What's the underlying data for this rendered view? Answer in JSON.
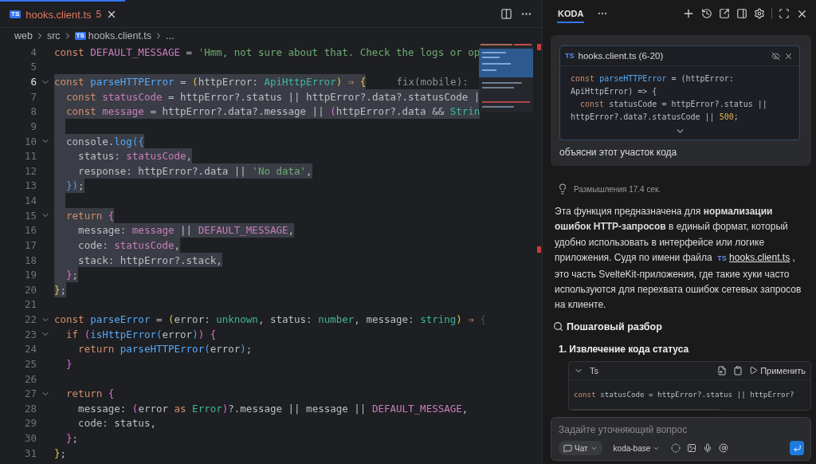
{
  "editor_tab": {
    "badge": "TS",
    "label": "hooks.client.ts",
    "problems": "5",
    "selected": true
  },
  "breadcrumb": [
    {
      "label": "web"
    },
    {
      "label": "src"
    },
    {
      "label": "hooks.client.ts",
      "badge": "TS"
    },
    {
      "label": "..."
    }
  ],
  "code_lines": [
    {
      "number": "4",
      "selected": false,
      "current": false,
      "foldable": false,
      "tokens": [
        {
          "kind": "kw",
          "text": "const "
        },
        {
          "kind": "var",
          "text": "DEFAULT_MESSAGE"
        },
        {
          "kind": "plain",
          "text": " = "
        },
        {
          "kind": "str",
          "text": "'Hmm, not sure about that. Check the logs or op"
        }
      ]
    },
    {
      "number": "5",
      "selected": false,
      "current": false,
      "foldable": false
    },
    {
      "number": "6",
      "selected": true,
      "current": true,
      "foldable": true,
      "annotation": "fix(mobile):",
      "tokens": [
        {
          "kind": "kw",
          "text": "const "
        },
        {
          "kind": "fn",
          "text": "parseHTTPError"
        },
        {
          "kind": "plain",
          "text": " = "
        },
        {
          "kind": "b1",
          "text": "("
        },
        {
          "kind": "plain",
          "text": "httpError: "
        },
        {
          "kind": "type",
          "text": "ApiHttpError"
        },
        {
          "kind": "b1",
          "text": ")"
        },
        {
          "kind": "kw",
          "text": " ⇒ "
        },
        {
          "kind": "b1",
          "text": "{"
        }
      ]
    },
    {
      "number": "7",
      "selected": true,
      "current": false,
      "foldable": false,
      "tokens": [
        {
          "kind": "kw",
          "text": "  const "
        },
        {
          "kind": "var",
          "text": "statusCode"
        },
        {
          "kind": "plain",
          "text": " = httpError?.status || httpError?.data?.statusCode |"
        }
      ]
    },
    {
      "number": "8",
      "selected": true,
      "current": false,
      "foldable": false,
      "tokens": [
        {
          "kind": "kw",
          "text": "  const "
        },
        {
          "kind": "var",
          "text": "message"
        },
        {
          "kind": "plain",
          "text": " = httpError?.data?.message || "
        },
        {
          "kind": "b2",
          "text": "("
        },
        {
          "kind": "plain",
          "text": "httpError?.data && "
        },
        {
          "kind": "type",
          "text": "Strin"
        }
      ]
    },
    {
      "number": "9",
      "selected": true,
      "current": false,
      "foldable": false
    },
    {
      "number": "10",
      "selected": true,
      "current": false,
      "foldable": true,
      "tokens": [
        {
          "kind": "plain",
          "text": "  console."
        },
        {
          "kind": "fn",
          "text": "log"
        },
        {
          "kind": "b3",
          "text": "({"
        }
      ]
    },
    {
      "number": "11",
      "selected": true,
      "current": false,
      "foldable": false,
      "tokens": [
        {
          "kind": "plain",
          "text": "    status: "
        },
        {
          "kind": "var",
          "text": "statusCode"
        },
        {
          "kind": "plain",
          "text": ","
        }
      ]
    },
    {
      "number": "12",
      "selected": true,
      "current": false,
      "foldable": false,
      "tokens": [
        {
          "kind": "plain",
          "text": "    response: httpError?.data || "
        },
        {
          "kind": "str",
          "text": "'No data'"
        },
        {
          "kind": "plain",
          "text": ","
        }
      ]
    },
    {
      "number": "13",
      "selected": true,
      "current": false,
      "foldable": false,
      "tokens": [
        {
          "kind": "b3",
          "text": "  })"
        },
        {
          "kind": "plain",
          "text": ";"
        }
      ]
    },
    {
      "number": "14",
      "selected": true,
      "current": false,
      "foldable": false
    },
    {
      "number": "15",
      "selected": true,
      "current": false,
      "foldable": true,
      "tokens": [
        {
          "kind": "kw",
          "text": "  return "
        },
        {
          "kind": "b2",
          "text": "{"
        }
      ]
    },
    {
      "number": "16",
      "selected": true,
      "current": false,
      "foldable": false,
      "tokens": [
        {
          "kind": "plain",
          "text": "    message: "
        },
        {
          "kind": "var",
          "text": "message"
        },
        {
          "kind": "plain",
          "text": " || "
        },
        {
          "kind": "var",
          "text": "DEFAULT_MESSAGE"
        },
        {
          "kind": "plain",
          "text": ","
        }
      ]
    },
    {
      "number": "17",
      "selected": true,
      "current": false,
      "foldable": false,
      "tokens": [
        {
          "kind": "plain",
          "text": "    code: "
        },
        {
          "kind": "var",
          "text": "statusCode"
        },
        {
          "kind": "plain",
          "text": ","
        }
      ]
    },
    {
      "number": "18",
      "selected": true,
      "current": false,
      "foldable": false,
      "tokens": [
        {
          "kind": "plain",
          "text": "    stack: httpError?.stack,"
        }
      ]
    },
    {
      "number": "19",
      "selected": true,
      "current": false,
      "foldable": false,
      "tokens": [
        {
          "kind": "b2",
          "text": "  }"
        },
        {
          "kind": "plain",
          "text": ";"
        }
      ]
    },
    {
      "number": "20",
      "selected": true,
      "current": false,
      "foldable": false,
      "tokens": [
        {
          "kind": "b1",
          "text": "}"
        },
        {
          "kind": "plain",
          "text": ";"
        }
      ]
    },
    {
      "number": "21",
      "selected": false,
      "current": false,
      "foldable": false
    },
    {
      "number": "22",
      "selected": false,
      "current": false,
      "foldable": true,
      "tokens": [
        {
          "kind": "kw",
          "text": "const "
        },
        {
          "kind": "fn",
          "text": "parseError"
        },
        {
          "kind": "plain",
          "text": " = "
        },
        {
          "kind": "b1",
          "text": "("
        },
        {
          "kind": "plain",
          "text": "error: "
        },
        {
          "kind": "type",
          "text": "unknown"
        },
        {
          "kind": "plain",
          "text": ", status: "
        },
        {
          "kind": "type",
          "text": "number"
        },
        {
          "kind": "plain",
          "text": ", message: "
        },
        {
          "kind": "type",
          "text": "string"
        },
        {
          "kind": "b1",
          "text": ")"
        },
        {
          "kind": "kw",
          "text": " ⇒ "
        },
        {
          "kind": "dim",
          "text": "{"
        }
      ]
    },
    {
      "number": "23",
      "selected": false,
      "current": false,
      "foldable": true,
      "tokens": [
        {
          "kind": "kw",
          "text": "  if "
        },
        {
          "kind": "b2",
          "text": "("
        },
        {
          "kind": "fn",
          "text": "isHttpError"
        },
        {
          "kind": "b3",
          "text": "("
        },
        {
          "kind": "plain",
          "text": "error"
        },
        {
          "kind": "b3",
          "text": ")"
        },
        {
          "kind": "b2",
          "text": ") {"
        }
      ]
    },
    {
      "number": "24",
      "selected": false,
      "current": false,
      "foldable": false,
      "tokens": [
        {
          "kind": "kw",
          "text": "    return "
        },
        {
          "kind": "fn",
          "text": "parseHTTPError"
        },
        {
          "kind": "b3",
          "text": "("
        },
        {
          "kind": "plain",
          "text": "error"
        },
        {
          "kind": "b3",
          "text": ")"
        },
        {
          "kind": "plain",
          "text": ";"
        }
      ]
    },
    {
      "number": "25",
      "selected": false,
      "current": false,
      "foldable": false,
      "tokens": [
        {
          "kind": "b2",
          "text": "  }"
        }
      ]
    },
    {
      "number": "26",
      "selected": false,
      "current": false,
      "foldable": false
    },
    {
      "number": "27",
      "selected": false,
      "current": false,
      "foldable": true,
      "tokens": [
        {
          "kind": "kw",
          "text": "  return "
        },
        {
          "kind": "b2",
          "text": "{"
        }
      ]
    },
    {
      "number": "28",
      "selected": false,
      "current": false,
      "foldable": false,
      "tokens": [
        {
          "kind": "plain",
          "text": "    message: "
        },
        {
          "kind": "b2",
          "text": "("
        },
        {
          "kind": "plain",
          "text": "error "
        },
        {
          "kind": "kw",
          "text": "as "
        },
        {
          "kind": "type",
          "text": "Error"
        },
        {
          "kind": "b2",
          "text": ")"
        },
        {
          "kind": "plain",
          "text": "?.message || message || "
        },
        {
          "kind": "var",
          "text": "DEFAULT_MESSAGE"
        },
        {
          "kind": "plain",
          "text": ","
        }
      ]
    },
    {
      "number": "29",
      "selected": false,
      "current": false,
      "foldable": false,
      "tokens": [
        {
          "kind": "plain",
          "text": "    code: status,"
        }
      ]
    },
    {
      "number": "30",
      "selected": false,
      "current": false,
      "foldable": false,
      "tokens": [
        {
          "kind": "b2",
          "text": "  }"
        },
        {
          "kind": "plain",
          "text": ";"
        }
      ]
    },
    {
      "number": "31",
      "selected": false,
      "current": false,
      "foldable": false,
      "tokens": [
        {
          "kind": "b1",
          "text": "}"
        },
        {
          "kind": "plain",
          "text": ";"
        }
      ]
    }
  ],
  "panel": {
    "tabs": [
      {
        "label": "KODA",
        "selected": true
      }
    ]
  },
  "user_message": {
    "context": {
      "badge": "TS",
      "title": "hooks.client.ts (6-20)",
      "lines": [
        [
          {
            "kind": "kw",
            "text": "const "
          },
          {
            "kind": "fn",
            "text": "parseHTTPError"
          },
          {
            "kind": "plain",
            "text": " = (httpError:"
          }
        ],
        [
          {
            "kind": "plain",
            "text": "ApiHttpError) => {"
          }
        ],
        [
          {
            "kind": "kw",
            "text": "  const "
          },
          {
            "kind": "plain",
            "text": "statusCode = httpError?.status ||"
          }
        ],
        [
          {
            "kind": "plain",
            "text": "httpError?.data?.statusCode || "
          },
          {
            "kind": "num",
            "text": "500"
          },
          {
            "kind": "plain",
            "text": ";"
          }
        ]
      ]
    },
    "text": "объясни этот участок кода"
  },
  "thinking": "Размышления 17.4 сек.",
  "answer": {
    "before": "Эта функция предназначена для **нормализации ошибок HTTP-запросов** в единый формат, который удобно использовать в интерфейсе или логике приложения. Судя по имени файла",
    "file_badge": "TS",
    "file_link": "hooks.client.ts",
    "after": " , это часть SvelteKit-приложения, где такие хуки часто используются для перехвата ошибок сетевых запросов на клиенте."
  },
  "section_heading": "Пошаговый разбор",
  "steps": [
    {
      "title": "1. Извлечение кода статуса",
      "code_block": {
        "language": "Ts",
        "apply_label": "Применить",
        "lines": [
          [
            {
              "kind": "kw",
              "text": "const "
            },
            {
              "kind": "plain",
              "text": "statusCode = httpError?.status || httpError?"
            }
          ]
        ]
      }
    }
  ],
  "composer": {
    "placeholder": "Задайте уточняющий вопрос",
    "mode": "Чат",
    "model": "koda-base"
  }
}
